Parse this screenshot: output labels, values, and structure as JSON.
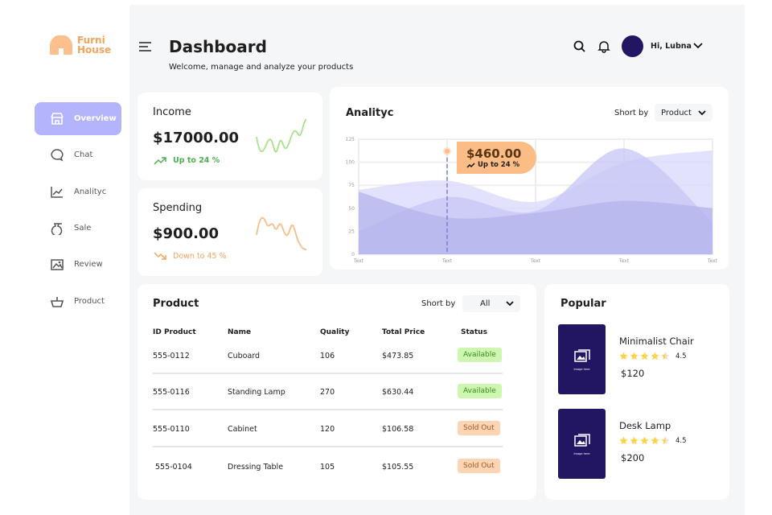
{
  "brand": {
    "line1": "Furni",
    "line2": "House",
    "color": "#f5a35c"
  },
  "sidebar": {
    "items": [
      {
        "label": "Overview",
        "icon": "store-icon",
        "active": true
      },
      {
        "label": "Chat",
        "icon": "chat-icon"
      },
      {
        "label": "Analityc",
        "icon": "chart-icon"
      },
      {
        "label": "Sale",
        "icon": "bag-icon"
      },
      {
        "label": "Review",
        "icon": "image-icon"
      },
      {
        "label": "Product",
        "icon": "basket-icon"
      }
    ]
  },
  "header": {
    "title": "Dashboard",
    "subtitle": "Welcome, manage and analyze your products",
    "user": "Hi, Lubna"
  },
  "income": {
    "label": "Income",
    "value": "$17000.00",
    "trend": "Up to 24 %",
    "color": "#4caf50"
  },
  "spending": {
    "label": "Spending",
    "value": "$900.00",
    "trend": "Down to 45 %",
    "color": "#f5a35c"
  },
  "analytic": {
    "title": "Analityc",
    "sort_label": "Short by",
    "sort_value": "Product",
    "tooltip_value": "$460.00",
    "tooltip_trend": "Up to 24 %"
  },
  "chart_data": {
    "type": "area",
    "x": [
      "Text",
      "Text",
      "Text",
      "Text",
      "Text"
    ],
    "yticks": [
      "125",
      "100",
      "75",
      "50",
      "25",
      "0"
    ],
    "ylim": [
      0,
      125
    ],
    "grid": true,
    "series": [
      {
        "values": [
          70,
          80,
          57,
          100,
          113
        ]
      },
      {
        "values": [
          25,
          62,
          47,
          115,
          35
        ]
      },
      {
        "values": [
          68,
          40,
          45,
          58,
          50
        ]
      }
    ],
    "colors": [
      "#d8d8fb",
      "#c5c5f7",
      "#b3b3ec"
    ]
  },
  "product": {
    "title": "Product",
    "sort_label": "Short by",
    "sort_value": "All",
    "columns": [
      "ID Product",
      "Name",
      "Quality",
      "Total Price",
      "Status"
    ],
    "rows": [
      {
        "id": "555-0112",
        "name": "Cuboard",
        "qty": "106",
        "price": "$473.85",
        "status": "Available"
      },
      {
        "id": "555-0116",
        "name": "Standing Lamp",
        "qty": "270",
        "price": "$630.44",
        "status": "Available"
      },
      {
        "id": "555-0110",
        "name": "Cabinet",
        "qty": "120",
        "price": "$106.58",
        "status": "Sold Out"
      },
      {
        "id": "555-0104",
        "name": "Dressing Table",
        "qty": "105",
        "price": "$105.55",
        "status": "Sold Out"
      }
    ]
  },
  "popular": {
    "title": "Popular",
    "items": [
      {
        "name": "Minimalist Chair",
        "rating": "4.5",
        "price": "$120",
        "img": "Image here"
      },
      {
        "name": "Desk Lamp",
        "rating": "4.5",
        "price": "$200",
        "img": "Image here"
      }
    ]
  }
}
